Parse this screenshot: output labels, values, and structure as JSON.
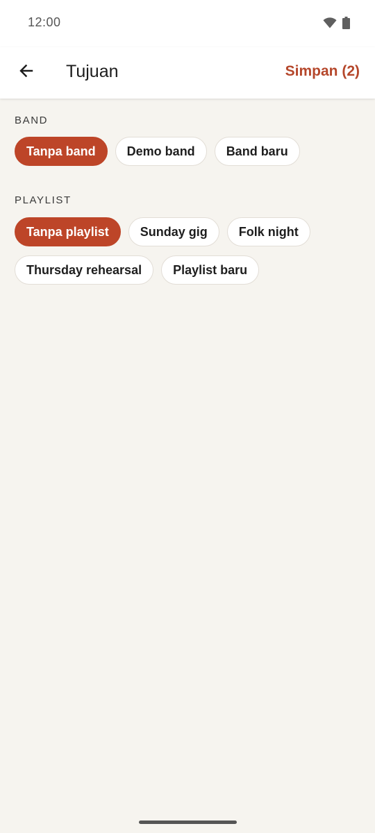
{
  "status_bar": {
    "time": "12:00",
    "icons": [
      "wifi-icon",
      "battery-icon"
    ]
  },
  "app_bar": {
    "back_icon": "arrow-left-icon",
    "title": "Tujuan",
    "save_label": "Simpan (2)"
  },
  "sections": {
    "band": {
      "label": "BAND",
      "chips": [
        {
          "label": "Tanpa band",
          "selected": true
        },
        {
          "label": "Demo band",
          "selected": false
        },
        {
          "label": "Band baru",
          "selected": false
        }
      ]
    },
    "playlist": {
      "label": "PLAYLIST",
      "chips": [
        {
          "label": "Tanpa playlist",
          "selected": true
        },
        {
          "label": "Sunday gig",
          "selected": false
        },
        {
          "label": "Folk night",
          "selected": false
        },
        {
          "label": "Thursday rehearsal",
          "selected": false
        },
        {
          "label": "Playlist baru",
          "selected": false
        }
      ]
    }
  },
  "colors": {
    "accent": "#bd4528",
    "background": "#f6f4ef",
    "surface": "#ffffff"
  }
}
